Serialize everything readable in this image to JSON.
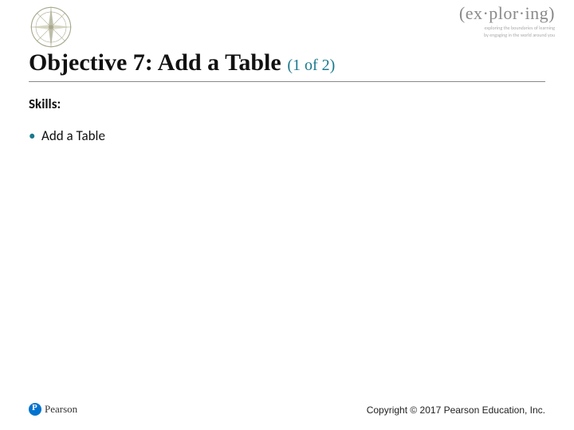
{
  "header": {
    "brand_main": "(ex·plor·ing)",
    "brand_sub1": "exploring the boundaries of learning",
    "brand_sub2": "by engaging in the world around you"
  },
  "title": {
    "main": "Objective 7: Add a Table",
    "sub": "(1 of 2)"
  },
  "body": {
    "skills_label": "Skills:",
    "bullets": [
      "Add a Table"
    ]
  },
  "footer": {
    "publisher": "Pearson",
    "copyright": "Copyright © 2017 Pearson Education, Inc."
  }
}
